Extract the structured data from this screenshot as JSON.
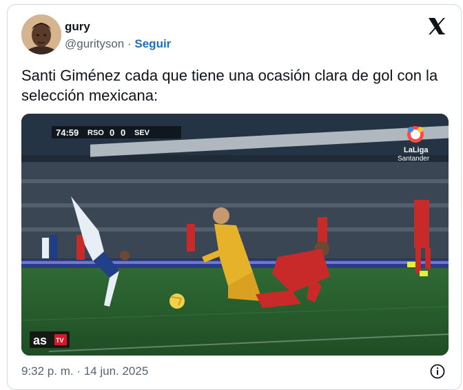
{
  "author": {
    "display_name": "gury",
    "handle": "@gurityson",
    "separator": "·",
    "follow_label": "Seguir"
  },
  "tweet": {
    "text": "Santi Giménez cada que tiene una ocasión clara de gol con la selección mexicana:"
  },
  "media": {
    "scoreboard": {
      "time": "74:59",
      "home": "RSO",
      "home_score": "0",
      "away_score": "0",
      "away": "SEV"
    },
    "league_logo_text": "LaLiga",
    "league_sponsor_text": "Santander",
    "broadcaster_logo": "as",
    "broadcaster_tv": "TV"
  },
  "footer": {
    "timestamp": "9:32 p. m. · 14 jun. 2025"
  },
  "icons": {
    "platform": "x-logo-icon",
    "info": "info-icon"
  }
}
